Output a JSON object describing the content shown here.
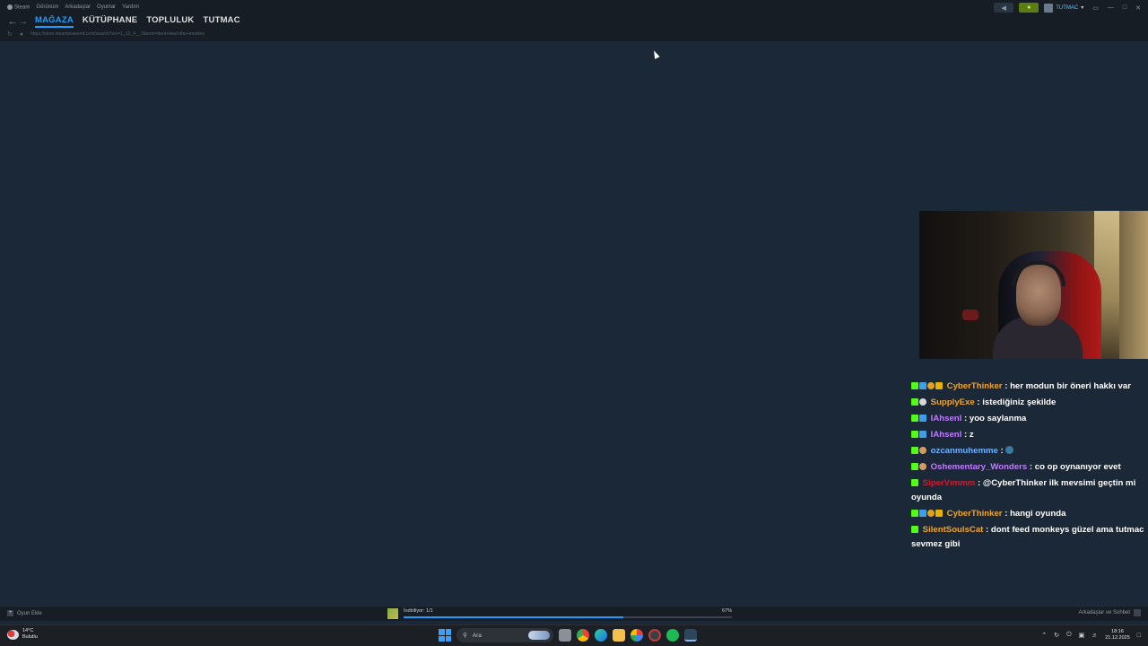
{
  "menu": {
    "items": [
      "Steam",
      "Görünüm",
      "Arkadaşlar",
      "Oyunlar",
      "Yardım"
    ]
  },
  "nav": {
    "tabs": [
      "MAĞAZA",
      "KÜTÜPHANE",
      "TOPLULUK",
      "TUTMAC"
    ],
    "active_tab": "MAĞAZA"
  },
  "urlbar": {
    "url": "https://store.steampowered.com/search?snr=1_12_4__7&term=dont+feed+the+monkey"
  },
  "account": {
    "name": "TUTMAC"
  },
  "chat": {
    "messages": [
      {
        "user": "CyberThinker",
        "text": ": her modun bir öneri hakkı var"
      },
      {
        "user": "SupplyExe",
        "text": ": istediğiniz şekilde"
      },
      {
        "user": "IAhsenI",
        "text": ": yoo saylanma"
      },
      {
        "user": "IAhsenI",
        "text": ": z"
      },
      {
        "user": "ozcanmuhemme",
        "text": ":"
      },
      {
        "user": "Oshementary_Wonders",
        "text": ": co op oynanıyor evet"
      },
      {
        "user": "SiperVımmm",
        "text": ": @CyberThinker ilk mevsimi geçtin mi oyunda"
      },
      {
        "user": "CyberThinker",
        "text": ": hangi oyunda"
      },
      {
        "user": "SilentSoulsCat",
        "text": ": dont feed monkeys güzel ama tutmac sevmez gibi"
      }
    ]
  },
  "bottombar": {
    "add_game": "Oyun Ekle",
    "download_status": "İndiriliyor: 1/1",
    "download_percent": "67%",
    "download_progress": 0.67,
    "friends_chat": "Arkadaşlar ve Sohbet"
  },
  "taskbar": {
    "weather_temp": "14°C",
    "weather_desc": "Bulutlu",
    "search_placeholder": "Ara",
    "time": "18:16",
    "date": "21.12.2025"
  },
  "colors": {
    "accent": "#1a9fff",
    "background": "#1b2838",
    "notification": "#5c7e10"
  }
}
